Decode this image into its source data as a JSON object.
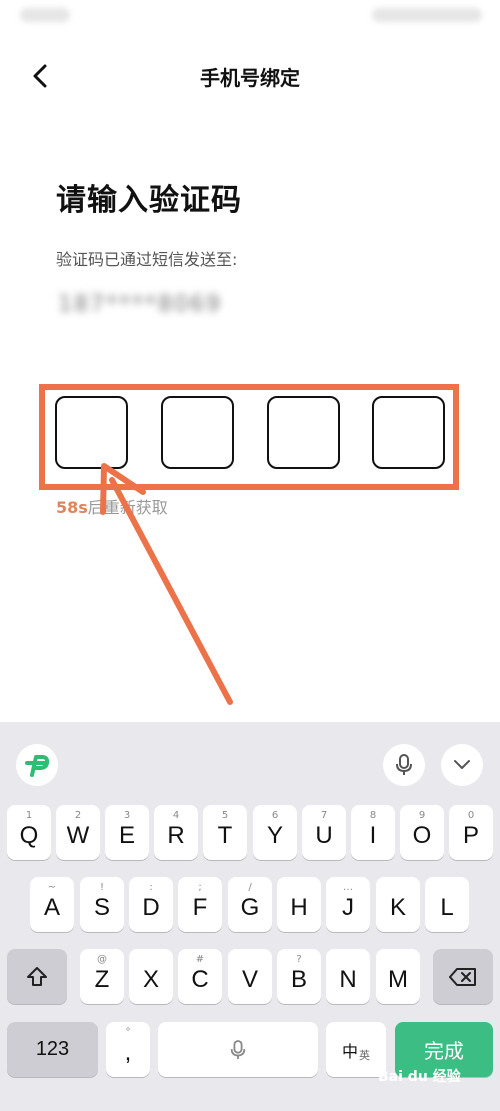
{
  "nav": {
    "title": "手机号绑定"
  },
  "content": {
    "heading": "请输入验证码",
    "subtitle": "验证码已通过短信发送至:",
    "phone_masked": "187****8069",
    "code_boxes": [
      "",
      "",
      "",
      ""
    ],
    "resend_seconds": "58s",
    "resend_text": "后重新获取"
  },
  "colors": {
    "annotation": "#ec7349",
    "accent": "#2ebd75",
    "done_key": "#3bbd84"
  },
  "icons": [
    "back-arrow-icon",
    "app-logo-icon",
    "microphone-icon",
    "chevron-down-icon",
    "shift-icon",
    "backspace-icon"
  ],
  "keyboard": {
    "row1": [
      {
        "hint": "1",
        "key": "Q"
      },
      {
        "hint": "2",
        "key": "W"
      },
      {
        "hint": "3",
        "key": "E"
      },
      {
        "hint": "4",
        "key": "R"
      },
      {
        "hint": "5",
        "key": "T"
      },
      {
        "hint": "6",
        "key": "Y"
      },
      {
        "hint": "7",
        "key": "U"
      },
      {
        "hint": "8",
        "key": "I"
      },
      {
        "hint": "9",
        "key": "O"
      },
      {
        "hint": "0",
        "key": "P"
      }
    ],
    "row2": [
      {
        "hint": "~",
        "key": "A"
      },
      {
        "hint": "!",
        "key": "S"
      },
      {
        "hint": ":",
        "key": "D"
      },
      {
        "hint": ";",
        "key": "F"
      },
      {
        "hint": "/",
        "key": "G"
      },
      {
        "hint": "",
        "key": "H"
      },
      {
        "hint": "…",
        "key": "J"
      },
      {
        "hint": "",
        "key": "K"
      },
      {
        "hint": "",
        "key": "L"
      }
    ],
    "row3": [
      {
        "hint": "@",
        "key": "Z"
      },
      {
        "hint": "",
        "key": "X"
      },
      {
        "hint": "#",
        "key": "C"
      },
      {
        "hint": "",
        "key": "V"
      },
      {
        "hint": "?",
        "key": "B"
      },
      {
        "hint": "",
        "key": "N"
      },
      {
        "hint": "",
        "key": "M"
      }
    ],
    "num_label": "123",
    "punct_hint": "°",
    "punct_label": ",",
    "lang_main": "中",
    "lang_sub": "英",
    "done_label": "完成"
  },
  "watermark": "Bai du 经验"
}
